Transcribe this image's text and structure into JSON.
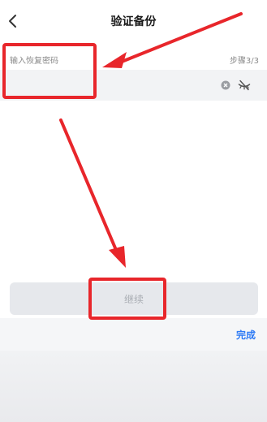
{
  "nav": {
    "title": "验证备份",
    "back_icon": "chevron-left-icon"
  },
  "form": {
    "field_label": "输入恢复密码",
    "step": "步骤3/3",
    "password_value": "",
    "clear_icon": "clear-circle-icon",
    "visibility_icon": "eye-off-icon"
  },
  "actions": {
    "continue_label": "继续",
    "done_label": "完成"
  },
  "colors": {
    "annotation": "#e8262b",
    "accent": "#2f7bf5",
    "button_disabled": "#e6e8ec"
  }
}
